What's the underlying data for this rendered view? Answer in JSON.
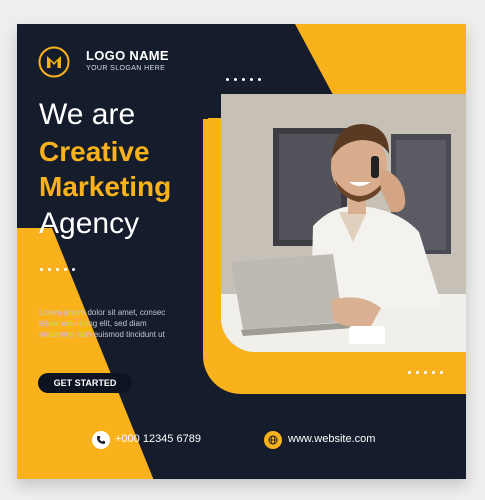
{
  "brand": {
    "logo_name": "LOGO NAME",
    "slogan": "YOUR SLOGAN HERE",
    "colors": {
      "accent": "#f9b21c",
      "background": "#151d2d"
    }
  },
  "headline": {
    "line1": "We are",
    "line2": "Creative",
    "line3": "Marketing",
    "line4": "Agency"
  },
  "body": {
    "line1": "Lorem ipsum dolor sit amet, consec",
    "line2": "tetuer adipiscing elit, sed diam",
    "line3": "nonummy nibh euismod tincidunt ut"
  },
  "cta": {
    "label": "GET STARTED"
  },
  "contact": {
    "phone": "+000 12345 6789",
    "website": "www.website.com",
    "phone_icon": "phone-icon",
    "web_icon": "globe-icon"
  }
}
